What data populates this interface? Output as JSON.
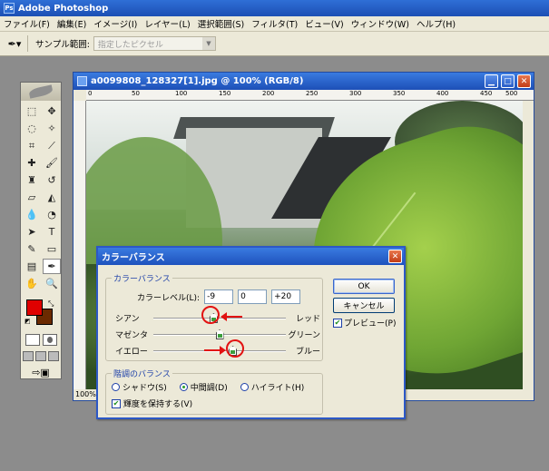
{
  "app": {
    "title": "Adobe Photoshop",
    "logo": "Ps"
  },
  "menu": [
    "ファイル(F)",
    "編集(E)",
    "イメージ(I)",
    "レイヤー(L)",
    "選択範囲(S)",
    "フィルタ(T)",
    "ビュー(V)",
    "ウィンドウ(W)",
    "ヘルプ(H)"
  ],
  "options": {
    "tool_icon": "eyedropper-icon",
    "sample_label": "サンプル範囲:",
    "sample_value": "指定したピクセル"
  },
  "document": {
    "title": "a0099808_128327[1].jpg @ 100% (RGB/8)",
    "zoom": "100%",
    "ruler_ticks": [
      "0",
      "50",
      "100",
      "150",
      "200",
      "250",
      "300",
      "350",
      "400",
      "450",
      "500"
    ]
  },
  "toolbox": {
    "fg_color": "#e00000",
    "bg_color": "#6b2a00"
  },
  "dialog": {
    "title": "カラーバランス",
    "group_color_balance": "カラーバランス",
    "color_level_label": "カラーレベル(L):",
    "levels": [
      "-9",
      "0",
      "+20"
    ],
    "sliders": [
      {
        "left": "シアン",
        "right": "レッド",
        "value": -9
      },
      {
        "left": "マゼンタ",
        "right": "グリーン",
        "value": 0
      },
      {
        "left": "イエロー",
        "right": "ブルー",
        "value": 20
      }
    ],
    "slider_range": [
      -100,
      100
    ],
    "group_tone": "階調のバランス",
    "radios": [
      "シャドウ(S)",
      "中間調(D)",
      "ハイライト(H)"
    ],
    "selected_radio": 1,
    "preserve_label": "輝度を保持する(V)",
    "preserve_checked": true,
    "ok": "OK",
    "cancel": "キャンセル",
    "preview_label": "プレビュー(P)",
    "preview_checked": true,
    "annotation_color": "#e21212"
  }
}
